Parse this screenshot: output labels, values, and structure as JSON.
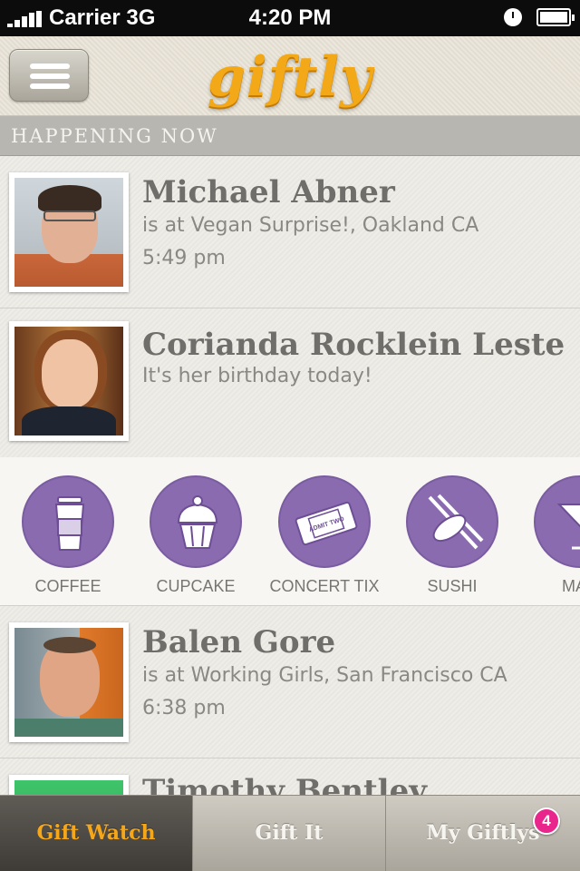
{
  "status_bar": {
    "carrier": "Carrier",
    "network": "3G",
    "time": "4:20 PM"
  },
  "header": {
    "logo": "giftly",
    "menu_icon": "hamburger-menu-icon"
  },
  "section": {
    "label": "HAPPENING NOW"
  },
  "feed": [
    {
      "name": "Michael Abner",
      "line1": "is at Vegan Surprise!, Oakland CA",
      "line2": "5:49 pm"
    },
    {
      "name": "Corianda Rocklein Leste",
      "line1": "It's her birthday today!",
      "line2": ""
    },
    {
      "name": "Balen Gore",
      "line1": "is at Working Girls, San Francisco CA",
      "line2": "6:38 pm"
    },
    {
      "name": "Timothy Bentley",
      "line1": "",
      "line2": ""
    }
  ],
  "gifts": [
    {
      "label": "COFFEE",
      "icon": "coffee-cup-icon"
    },
    {
      "label": "CUPCAKE",
      "icon": "cupcake-icon"
    },
    {
      "label": "CONCERT TIX",
      "icon": "ticket-icon",
      "ticket_text": "ADMIT TWO"
    },
    {
      "label": "SUSHI",
      "icon": "sushi-icon"
    },
    {
      "label": "MAR",
      "icon": "martini-icon"
    }
  ],
  "tabs": [
    {
      "label": "Gift Watch",
      "active": true
    },
    {
      "label": "Gift It",
      "active": false
    },
    {
      "label": "My Giftlys",
      "active": false,
      "badge": "4"
    }
  ],
  "colors": {
    "accent": "#f5a71c",
    "gift_purple": "#8a6bb0",
    "badge": "#e8268c"
  }
}
